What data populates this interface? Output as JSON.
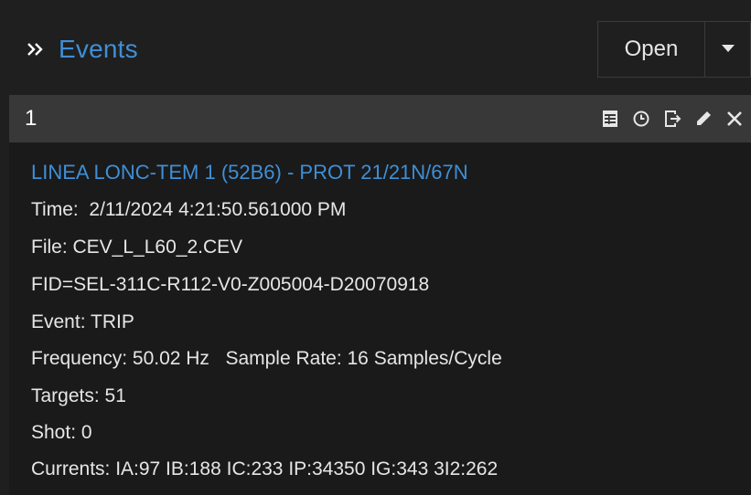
{
  "panel": {
    "title": "Events",
    "open_label": "Open"
  },
  "event": {
    "number": "1",
    "title": "LINEA LONC-TEM 1 (52B6) - PROT 21/21N/67N",
    "time": "Time:  2/11/2024 4:21:50.561000 PM",
    "file": "File: CEV_L_L60_2.CEV",
    "fid": "FID=SEL-311C-R112-V0-Z005004-D20070918",
    "event_type": "Event: TRIP",
    "frequency": "Frequency: 50.02 Hz   Sample Rate: 16 Samples/Cycle",
    "targets": "Targets: 51",
    "shot": "Shot: 0",
    "currents": "Currents: IA:97 IB:188 IC:233 IP:34350 IG:343 3I2:262"
  },
  "icons": {
    "collapse": "double-chevron-right-icon",
    "dropdown": "triangle-down-icon",
    "toolbar": [
      "table-icon",
      "clock-icon",
      "export-icon",
      "pencil-icon",
      "close-icon"
    ]
  },
  "colors": {
    "accent": "#3f8fd6",
    "background": "#1f1f1f",
    "event_bar": "#383838",
    "text": "#e6e6e6"
  }
}
